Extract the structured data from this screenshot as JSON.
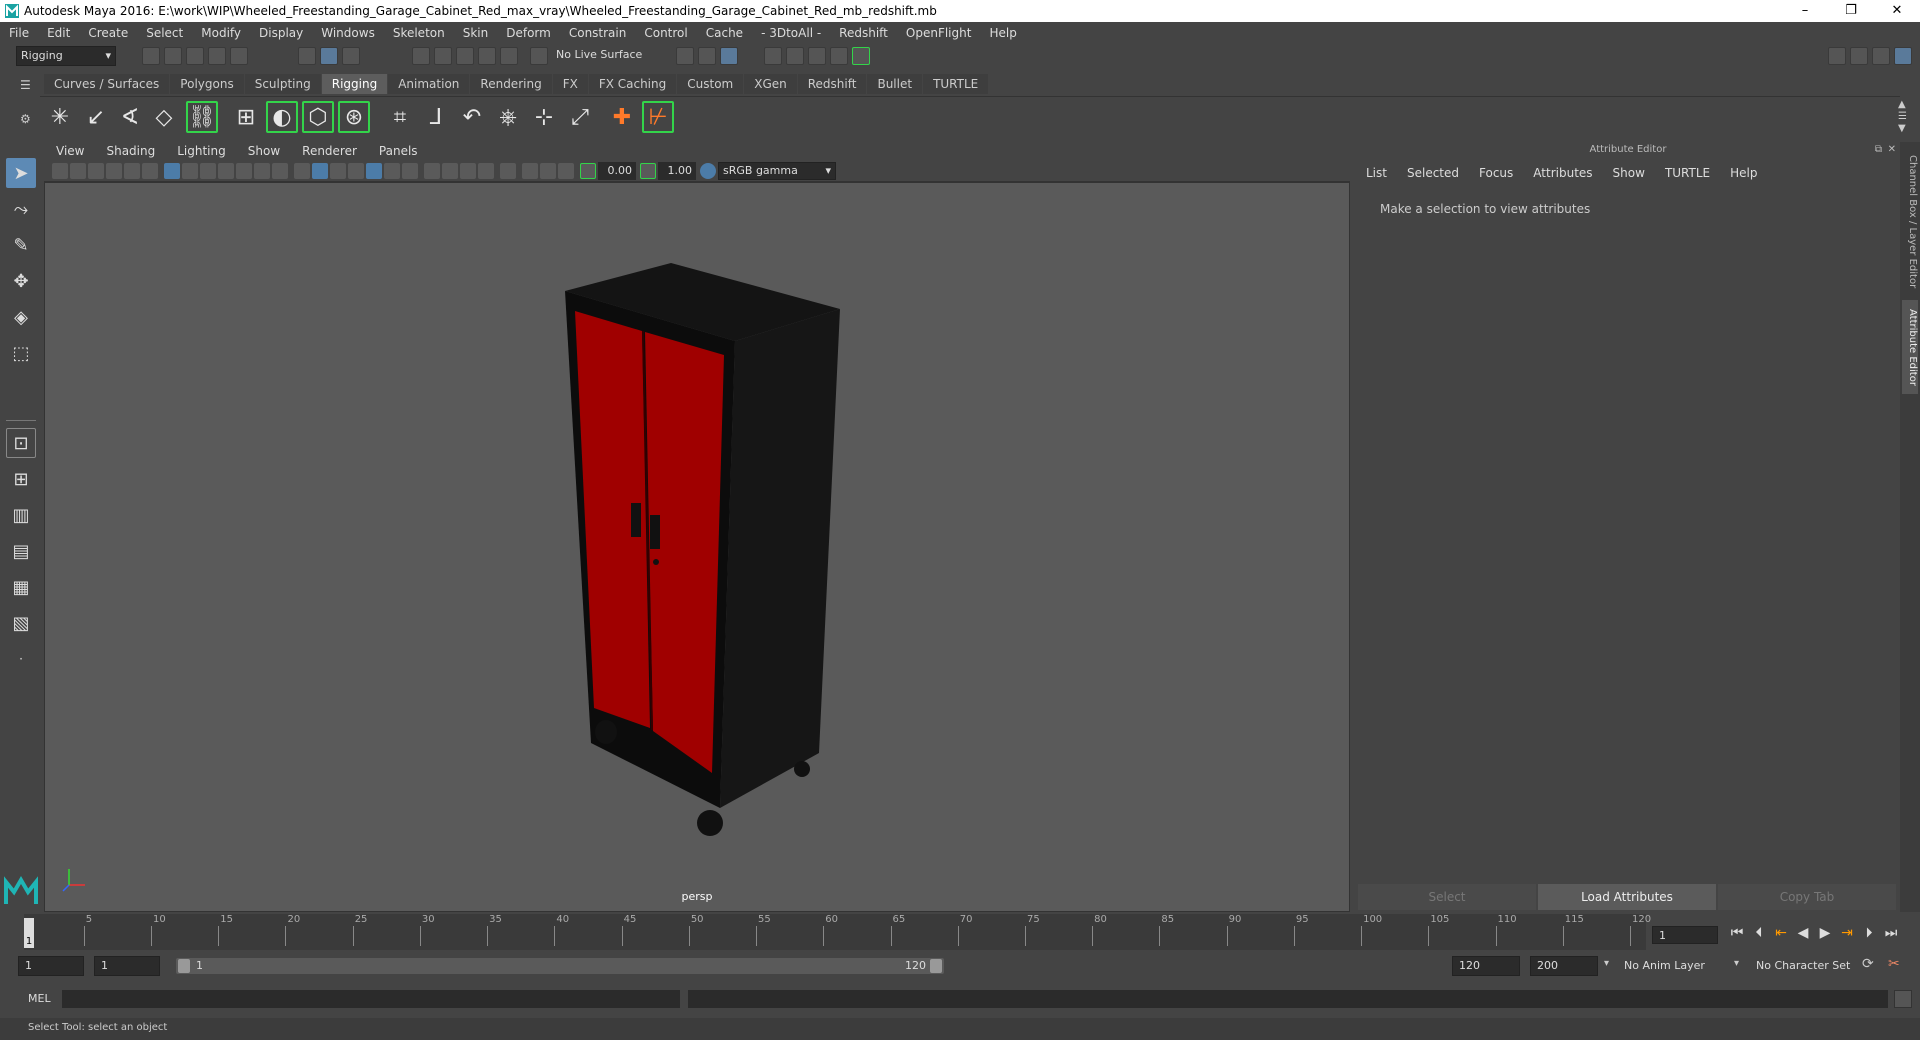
{
  "window": {
    "title": "Autodesk Maya 2016: E:\\work\\WIP\\Wheeled_Freestanding_Garage_Cabinet_Red_max_vray\\Wheeled_Freestanding_Garage_Cabinet_Red_mb_redshift.mb",
    "minimize": "–",
    "maximize": "❐",
    "close": "✕"
  },
  "menubar": [
    "File",
    "Edit",
    "Create",
    "Select",
    "Modify",
    "Display",
    "Windows",
    "Skeleton",
    "Skin",
    "Deform",
    "Constrain",
    "Control",
    "Cache",
    "- 3DtoAll -",
    "Redshift",
    "OpenFlight",
    "Help"
  ],
  "statusline": {
    "mode": "Rigging",
    "live_surface": "No Live Surface"
  },
  "shelf_tabs": [
    {
      "label": "Curves / Surfaces",
      "active": false
    },
    {
      "label": "Polygons",
      "active": false
    },
    {
      "label": "Sculpting",
      "active": false
    },
    {
      "label": "Rigging",
      "active": true
    },
    {
      "label": "Animation",
      "active": false
    },
    {
      "label": "Rendering",
      "active": false
    },
    {
      "label": "FX",
      "active": false
    },
    {
      "label": "FX Caching",
      "active": false
    },
    {
      "label": "Custom",
      "active": false
    },
    {
      "label": "XGen",
      "active": false
    },
    {
      "label": "Redshift",
      "active": false
    },
    {
      "label": "Bullet",
      "active": false
    },
    {
      "label": "TURTLE",
      "active": false
    }
  ],
  "viewport": {
    "menu": [
      "View",
      "Shading",
      "Lighting",
      "Show",
      "Renderer",
      "Panels"
    ],
    "exposure": "0.00",
    "gamma": "1.00",
    "color_space": "sRGB gamma",
    "camera_label": "persp",
    "colors": {
      "background": "#5a5a5a",
      "cabinet_body": "#1a1a1a",
      "door": "#a00000"
    }
  },
  "attribute_editor": {
    "header": "Attribute Editor",
    "menu": [
      "List",
      "Selected",
      "Focus",
      "Attributes",
      "Show",
      "TURTLE",
      "Help"
    ],
    "hint": "Make a selection to view attributes",
    "buttons": {
      "select": "Select",
      "load": "Load Attributes",
      "copy": "Copy Tab"
    }
  },
  "side_tabs": {
    "channel_box": "Channel Box / Layer Editor",
    "attribute_editor": "Attribute Editor"
  },
  "timeline": {
    "ticks": [
      "5",
      "10",
      "15",
      "20",
      "25",
      "30",
      "35",
      "40",
      "45",
      "50",
      "55",
      "60",
      "65",
      "70",
      "75",
      "80",
      "85",
      "90",
      "95",
      "100",
      "105",
      "110",
      "115",
      "120"
    ],
    "current_frame": "1",
    "frame_field": "1"
  },
  "range": {
    "start": "1",
    "playback_start": "1",
    "slider_start": "1",
    "slider_end": "120",
    "playback_end": "120",
    "end": "200",
    "anim_layer": "No Anim Layer",
    "character_set": "No Character Set"
  },
  "command": {
    "label": "MEL"
  },
  "help_line": "Select Tool: select an object"
}
